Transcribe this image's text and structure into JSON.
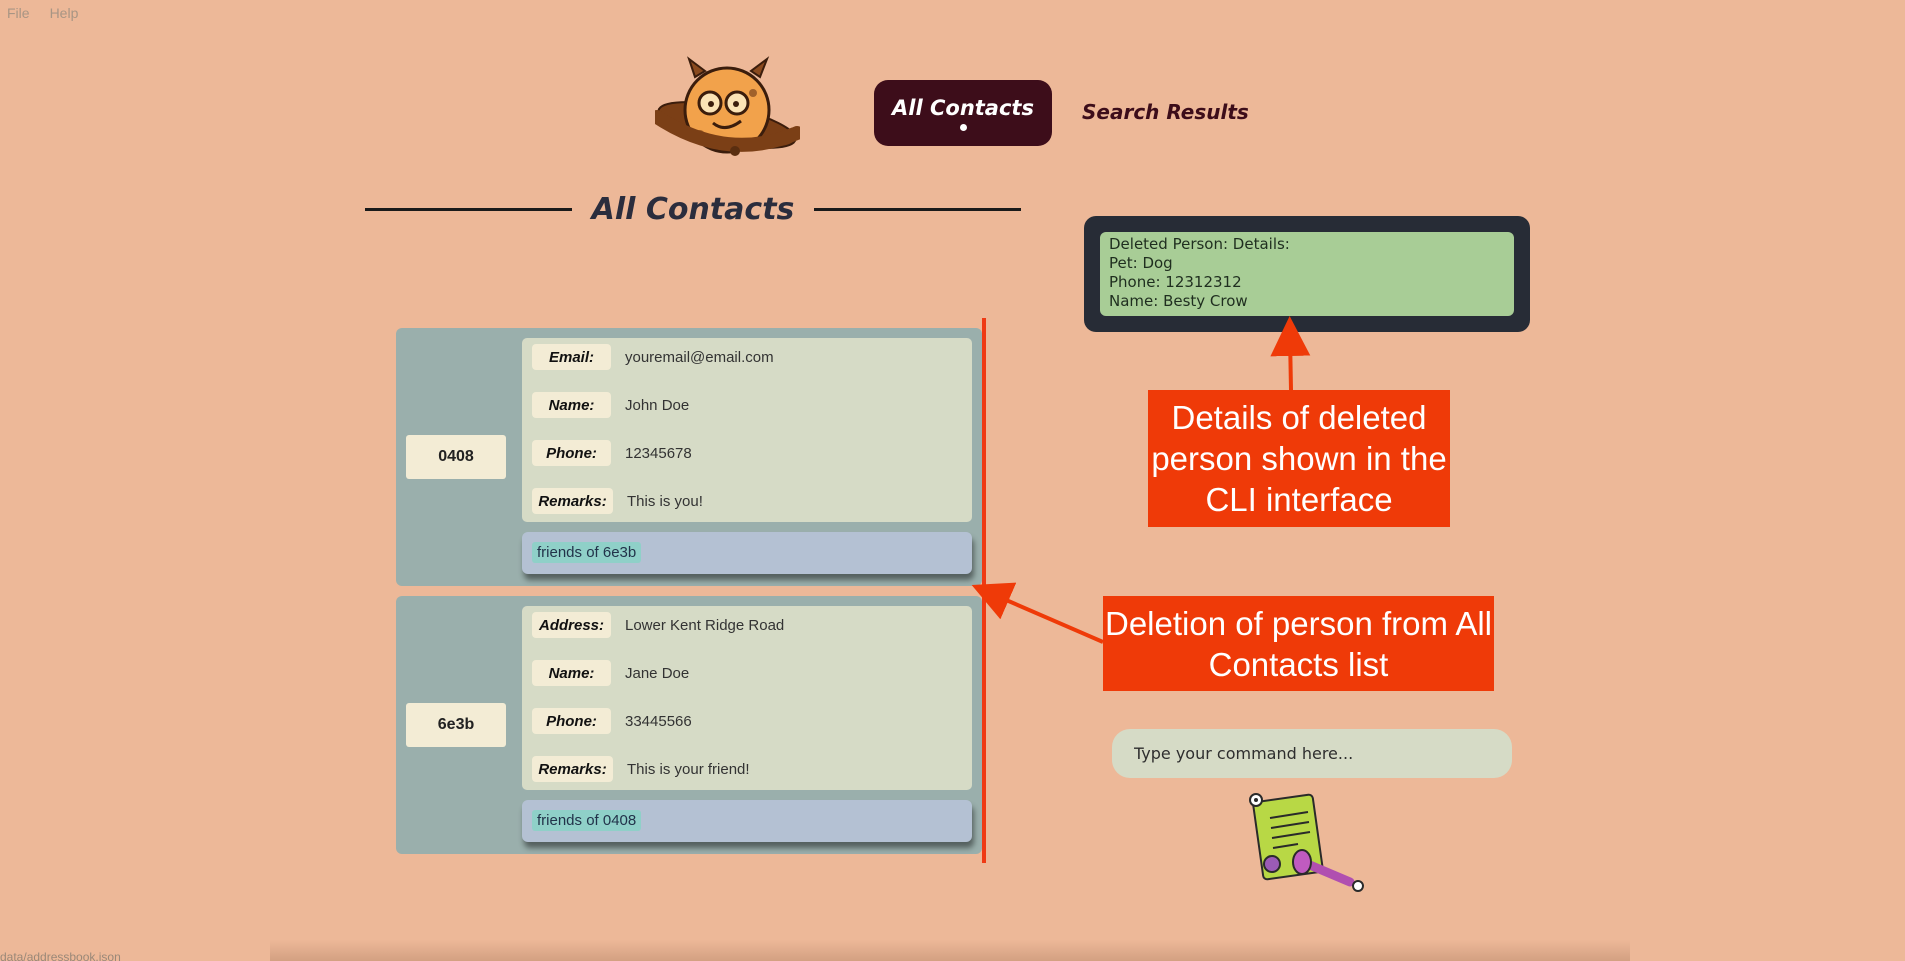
{
  "menu": {
    "file": "File",
    "help": "Help"
  },
  "tabs": {
    "all_contacts": "All Contacts",
    "search_results": "Search Results"
  },
  "section_title": "All Contacts",
  "contacts": [
    {
      "id": "0408",
      "fields": [
        {
          "label": "Email:",
          "value": "youremail@email.com"
        },
        {
          "label": "Name:",
          "value": "John Doe"
        },
        {
          "label": "Phone:",
          "value": "12345678"
        },
        {
          "label": "Remarks:",
          "value": "This is you!"
        }
      ],
      "tag": "friends of 6e3b"
    },
    {
      "id": "6e3b",
      "fields": [
        {
          "label": "Address:",
          "value": "Lower Kent Ridge Road"
        },
        {
          "label": "Name:",
          "value": "Jane Doe"
        },
        {
          "label": "Phone:",
          "value": "33445566"
        },
        {
          "label": "Remarks:",
          "value": "This is your friend!"
        }
      ],
      "tag": "friends of 0408"
    }
  ],
  "result_display": {
    "lines": [
      "Deleted Person: Details:",
      "Pet: Dog",
      "Phone: 12312312",
      "Name: Besty Crow"
    ]
  },
  "annotations": {
    "details_callout": "Details of deleted person shown in the CLI interface",
    "deletion_callout": "Deletion of person from All Contacts list",
    "accent_color": "#ef3a08"
  },
  "command_box": {
    "placeholder": "Type your command here..."
  },
  "status_bar": {
    "path": "data/addressbook.json"
  },
  "icons": {
    "logo": "planet-monster-icon",
    "mascot": "document-monster-icon"
  }
}
